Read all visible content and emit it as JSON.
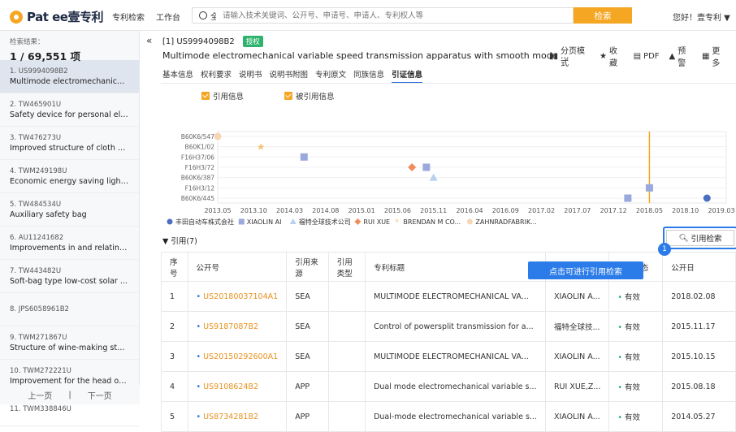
{
  "header": {
    "logo": "Pat ee壹专利",
    "nav": [
      "专利检索",
      "工作台"
    ],
    "scope": "全球",
    "search_placeholder": "请输入技术关键词、公开号、申请号、申请人、专利权人等",
    "search_button": "检索",
    "greeting": "您好！壹专利 ▼"
  },
  "sidebar": {
    "result_label": "检索结果：",
    "result_count": "1 / 69,551 项",
    "items": [
      {
        "id": "1. US9994098B2",
        "title": "Multimode electromechanical ..."
      },
      {
        "id": "2. TW465901U",
        "title": "Safety device for personal ele..."
      },
      {
        "id": "3. TW476273U",
        "title": "Improved structure of cloth ha..."
      },
      {
        "id": "4. TWM249198U",
        "title": "Economic energy saving light-..."
      },
      {
        "id": "5. TW484534U",
        "title": "Auxiliary safety bag"
      },
      {
        "id": "6. AU11241682",
        "title": "Improvements in and relating t..."
      },
      {
        "id": "7. TW443482U",
        "title": "Soft-bag type low-cost solar ..."
      },
      {
        "id": "8. JPS6058961B2",
        "title": ""
      },
      {
        "id": "9. TWM271867U",
        "title": "Structure of wine-making steri..."
      },
      {
        "id": "10. TWM272221U",
        "title": "Improvement for the head of n..."
      },
      {
        "id": "11. TWM338846U",
        "title": ""
      }
    ],
    "prev": "上一页",
    "sep": "|",
    "next": "下一页"
  },
  "patent": {
    "number": "[1] US9994098B2",
    "status": "授权",
    "title": "Multimode electromechanical variable speed transmission apparatus with smooth mode ...",
    "actions": [
      "分页模式",
      "收藏",
      "PDF",
      "预警",
      "更多"
    ]
  },
  "tabs": [
    "基本信息",
    "权利要求",
    "说明书",
    "说明书附图",
    "专利原文",
    "同族信息",
    "引证信息"
  ],
  "legend_top": [
    "引用信息",
    "被引用信息"
  ],
  "chart_data": {
    "type": "scatter",
    "y_categories": [
      "B60K6/547",
      "B60K1/02",
      "F16H37/06",
      "F16H3/72",
      "B60K6/387",
      "F16H3/12",
      "B60K6/445"
    ],
    "x_ticks": [
      "2013.05",
      "2013.10",
      "2014.03",
      "2014.08",
      "2015.01",
      "2015.06",
      "2015.11",
      "2016.04",
      "2016.09",
      "2017.02",
      "2017.07",
      "2017.12",
      "2018.05",
      "2018.10",
      "2019.03"
    ],
    "series": [
      {
        "name": "丰田自动车株式会社",
        "color": "#4a6fc0",
        "shape": "circle",
        "points": [
          {
            "x": "2019.01",
            "y": "B60K6/445"
          }
        ]
      },
      {
        "name": "XIAOLIN AI",
        "color": "#9aa9dd",
        "shape": "square",
        "points": [
          {
            "x": "2014.05",
            "y": "F16H37/06"
          },
          {
            "x": "2015.10",
            "y": "F16H3/72"
          },
          {
            "x": "2018.02",
            "y": "B60K6/445"
          },
          {
            "x": "2018.05",
            "y": "F16H3/12"
          }
        ]
      },
      {
        "name": "福特全球技术公司",
        "color": "#b7d1ee",
        "shape": "triangle",
        "points": [
          {
            "x": "2015.11",
            "y": "B60K6/387"
          }
        ]
      },
      {
        "name": "RUI XUE",
        "color": "#f08c5a",
        "shape": "diamond",
        "points": [
          {
            "x": "2015.08",
            "y": "F16H3/72"
          }
        ]
      },
      {
        "name": "BRENDAN M CO...",
        "color": "#f6c178",
        "shape": "star",
        "points": [
          {
            "x": "2013.11",
            "y": "B60K1/02"
          }
        ]
      },
      {
        "name": "ZAHNRADFABRIK...",
        "color": "#f7d6b5",
        "shape": "circle",
        "points": [
          {
            "x": "2013.05",
            "y": "B60K6/547"
          }
        ]
      }
    ],
    "marker_line": {
      "x": "2018.05",
      "color": "#f5a623"
    }
  },
  "cite": {
    "header": "▼ 引用(7)",
    "button": "引用检索",
    "tooltip": "点击可进行引用检索",
    "tip_num": "1",
    "columns": [
      "序号",
      "公开号",
      "引用来源",
      "引用类型",
      "专利标题",
      "",
      "法律状态",
      "公开日"
    ],
    "rows": [
      {
        "no": "1",
        "pn": "US20180037104A1",
        "src": "SEA",
        "type": "",
        "title": "MULTIMODE ELECTROMECHANICAL VA...",
        "assignee": "XIAOLIN A...",
        "status": "有效",
        "date": "2018.02.08"
      },
      {
        "no": "2",
        "pn": "US9187087B2",
        "src": "SEA",
        "type": "",
        "title": "Control of powersplit transmission for a...",
        "assignee": "福特全球技...",
        "status": "有效",
        "date": "2015.11.17"
      },
      {
        "no": "3",
        "pn": "US20150292600A1",
        "src": "SEA",
        "type": "",
        "title": "MULTIMODE ELECTROMECHANICAL VA...",
        "assignee": "XIAOLIN A...",
        "status": "有效",
        "date": "2015.10.15"
      },
      {
        "no": "4",
        "pn": "US9108624B2",
        "src": "APP",
        "type": "",
        "title": "Dual mode electromechanical variable s...",
        "assignee": "RUI XUE,Z...",
        "status": "有效",
        "date": "2015.08.18"
      },
      {
        "no": "5",
        "pn": "US8734281B2",
        "src": "APP",
        "type": "",
        "title": "Dual-mode electromechanical variable s...",
        "assignee": "XIAOLIN A...",
        "status": "有效",
        "date": "2014.05.27"
      }
    ]
  }
}
